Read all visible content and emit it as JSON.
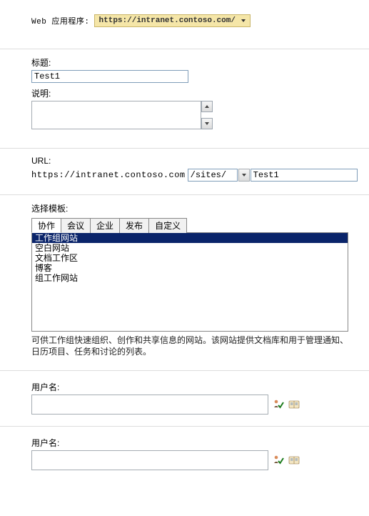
{
  "webapp": {
    "label": "Web 应用程序:",
    "value": "https://intranet.contoso.com/"
  },
  "title": {
    "label": "标题:",
    "value": "Test1"
  },
  "description": {
    "label": "说明:",
    "value": ""
  },
  "url": {
    "label": "URL:",
    "prefix": "https://intranet.contoso.com",
    "path": "/sites/",
    "name": "Test1"
  },
  "template": {
    "label": "选择模板:",
    "tabs": [
      "协作",
      "会议",
      "企业",
      "发布",
      "自定义"
    ],
    "active_tab": 0,
    "items": [
      "工作组网站",
      "空白网站",
      "文档工作区",
      "博客",
      "组工作网站"
    ],
    "selected": 0,
    "description": "可供工作组快速组织、创作和共享信息的网站。该网站提供文档库和用于管理通知、日历项目、任务和讨论的列表。"
  },
  "user1": {
    "label": "用户名:",
    "value": ""
  },
  "user2": {
    "label": "用户名:",
    "value": ""
  }
}
